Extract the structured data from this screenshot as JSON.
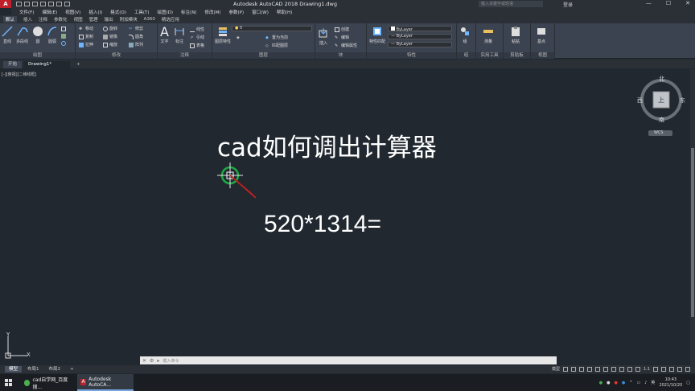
{
  "window": {
    "title": "Autodesk AutoCAD 2018   Drawing1.dwg",
    "search_placeholder": "键入关键字或短语",
    "user": "登录",
    "logo": "A"
  },
  "menu": [
    "文件(F)",
    "编辑(E)",
    "视图(V)",
    "插入(I)",
    "格式(O)",
    "工具(T)",
    "绘图(D)",
    "标注(N)",
    "修改(M)",
    "参数(P)",
    "窗口(W)",
    "帮助(H)"
  ],
  "ribbon_tabs": [
    "默认",
    "插入",
    "注释",
    "参数化",
    "视图",
    "管理",
    "输出",
    "附加模块",
    "A360",
    "精选应用"
  ],
  "ribbon": {
    "draw": {
      "label": "绘图",
      "line": "直线",
      "polyline": "多段线",
      "circle": "圆",
      "arc": "圆弧"
    },
    "modify": {
      "label": "修改",
      "move": "移动",
      "rotate": "旋转",
      "trim": "修剪",
      "copy": "复制",
      "mirror": "镜像",
      "fillet": "圆角",
      "stretch": "拉伸",
      "scale": "缩放",
      "array": "阵列"
    },
    "annotation": {
      "label": "注释",
      "text": "文字",
      "dimension": "标注",
      "linear": "线性",
      "leader": "引线",
      "table": "表格"
    },
    "layers": {
      "label": "图层",
      "layer_props": "图层特性",
      "current_layer": "0",
      "make_current": "置为当前",
      "match_layer": "匹配图层"
    },
    "block": {
      "label": "块",
      "insert": "插入",
      "create": "创建",
      "edit": "编辑",
      "edit_attr": "编辑属性"
    },
    "properties": {
      "label": "特性",
      "match": "特性匹配",
      "color": "ByLayer",
      "linetype": "ByLayer",
      "lineweight": "ByLayer"
    },
    "groups": {
      "label": "组",
      "group": "组"
    },
    "utilities": {
      "label": "实用工具",
      "measure": "测量"
    },
    "clipboard": {
      "label": "剪贴板",
      "paste": "粘贴"
    },
    "view": {
      "label": "视图",
      "base": "基点"
    }
  },
  "doc_tabs": [
    "开始",
    "Drawing1*",
    "+"
  ],
  "canvas": {
    "view_label": "[-][俯视][二维线框]",
    "heading": "cad如何调出计算器",
    "formula": "520*1314=",
    "viewcube": {
      "north": "北",
      "south": "南",
      "east": "东",
      "west": "西",
      "face": "上",
      "wcs": "WCS"
    },
    "ucs_x": "X",
    "ucs_y": "Y"
  },
  "command_line": {
    "placeholder": "键入命令"
  },
  "layout_tabs": [
    "模型",
    "布局1",
    "布局2",
    "+"
  ],
  "status": {
    "mode": "模型",
    "scale": "1:1"
  },
  "taskbar": {
    "items": [
      {
        "label": "cad自学网_百度搜..."
      },
      {
        "label": "Autodesk AutoCA..."
      }
    ],
    "time": "10:43",
    "date": "2021/10/20"
  }
}
